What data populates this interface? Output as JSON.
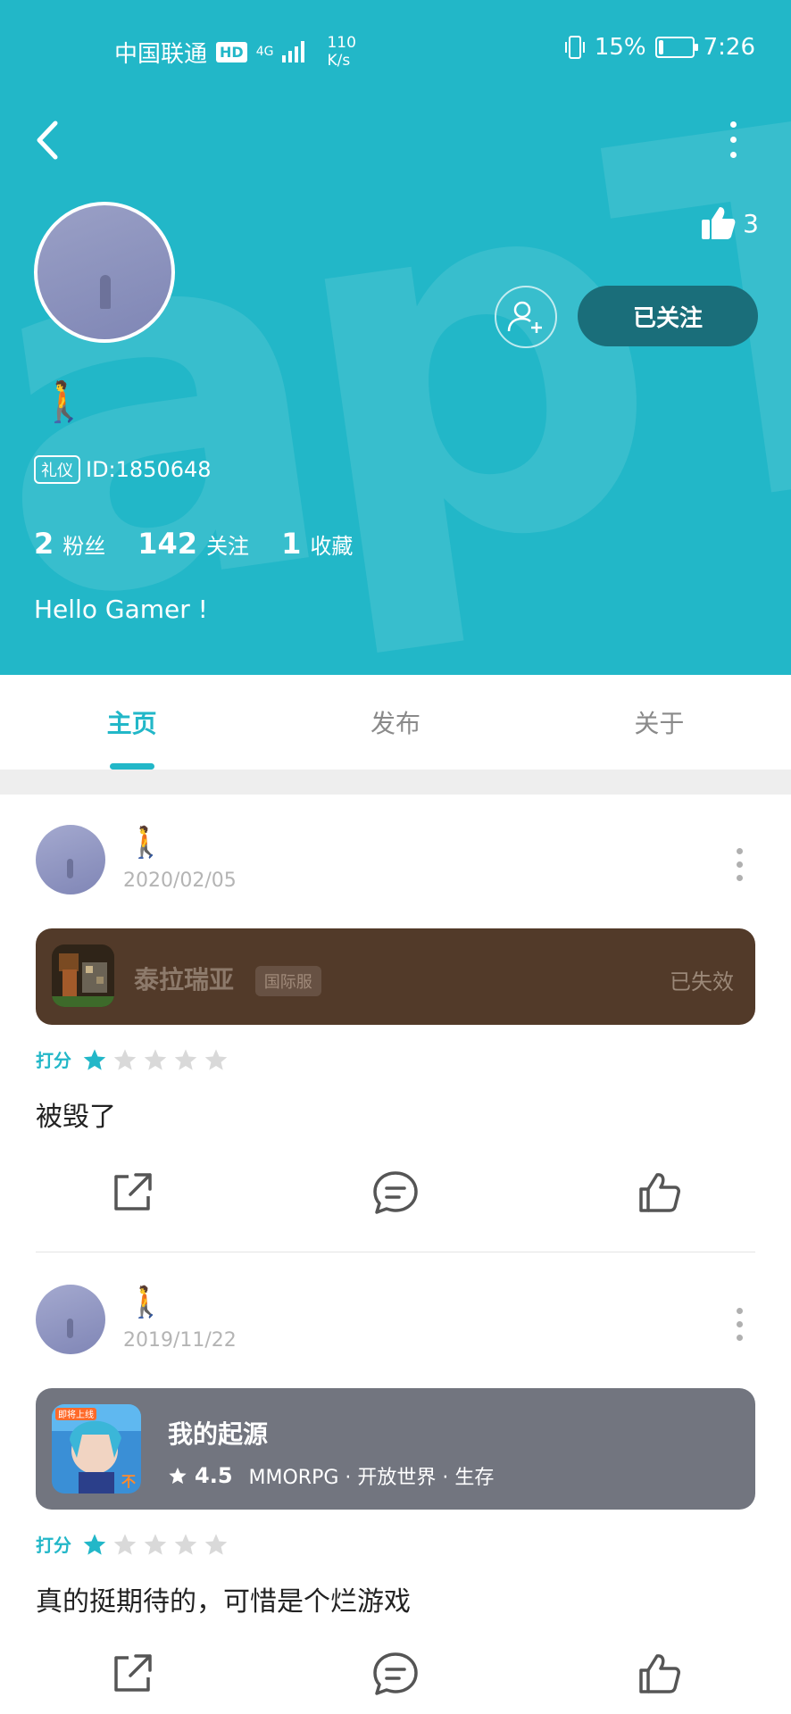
{
  "status_bar": {
    "carrier": "中国联通",
    "hd": "HD",
    "network": "4G",
    "speed_value": "110",
    "speed_unit": "K/s",
    "battery_percent": "15%",
    "battery_level": 0.15,
    "time": "7:26"
  },
  "profile": {
    "watermark": "apTap",
    "like_count": "3",
    "follow_label": "已关注",
    "user_emoji": "🚶",
    "id_badge": "礼仪",
    "id_text": "ID:1850648",
    "stats": {
      "fans_num": "2",
      "fans_label": "粉丝",
      "following_num": "142",
      "following_label": "关注",
      "favorites_num": "1",
      "favorites_label": "收藏"
    },
    "bio": "Hello Gamer !"
  },
  "tabs": [
    {
      "label": "主页",
      "active": true
    },
    {
      "label": "发布",
      "active": false
    },
    {
      "label": "关于",
      "active": false
    }
  ],
  "posts": [
    {
      "author_emoji": "🚶",
      "date": "2020/02/05",
      "game": {
        "title": "泰拉瑞亚",
        "tag": "国际服",
        "status": "已失效"
      },
      "rating_label": "打分",
      "rating": 1,
      "review": "被毁了"
    },
    {
      "author_emoji": "🚶",
      "date": "2019/11/22",
      "game": {
        "title": "我的起源",
        "score": "4.5",
        "tags": "MMORPG · 开放世界 · 生存",
        "icon_badge": "即将上线",
        "icon_mark": "不"
      },
      "rating_label": "打分",
      "rating": 1,
      "review": "真的挺期待的，可惜是个烂游戏"
    }
  ],
  "colors": {
    "accent": "#22b7c8",
    "follow_button": "#1a6e7a",
    "card_brown": "#523a29",
    "card_gray": "#72757f",
    "star_empty": "#d9d9d9"
  }
}
